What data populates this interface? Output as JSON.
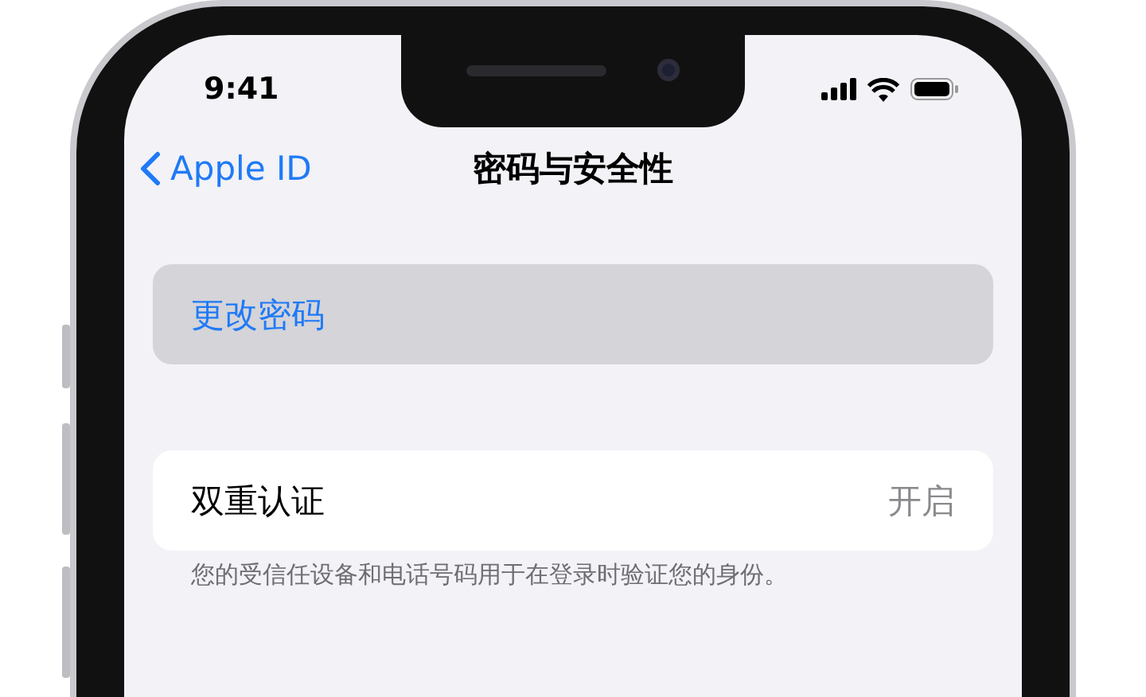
{
  "status_bar": {
    "time": "9:41"
  },
  "nav": {
    "back": "Apple ID",
    "title": "密码与安全性"
  },
  "sections": [
    {
      "rows": [
        {
          "kind": "action",
          "label": "更改密码",
          "selected": true
        }
      ]
    },
    {
      "rows": [
        {
          "kind": "detail",
          "label": "双重认证",
          "value": "开启",
          "selected": false
        }
      ],
      "footer": "您的受信任设备和电话号码用于在登录时验证您的身份。"
    }
  ]
}
